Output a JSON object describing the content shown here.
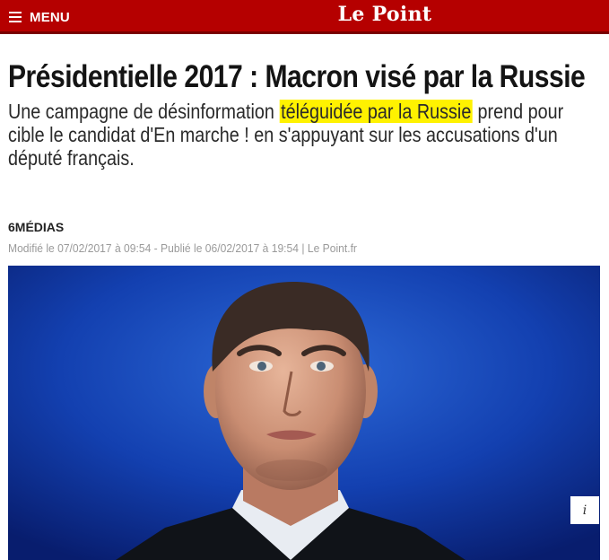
{
  "header": {
    "menu_label": "MENU",
    "brand": "Le Point"
  },
  "article": {
    "title": "Présidentielle 2017 : Macron visé par la Russie",
    "lede_before": "Une campagne de désinformation ",
    "lede_highlight": "téléguidée par la Russie",
    "lede_after": " prend pour cible le candidat d'En marche ! en s'appuyant sur les accusations d'un député français.",
    "author": "6MÉDIAS",
    "dates": "Modifié le 07/02/2017 à 09:54 - Publié le 06/02/2017 à 19:54 | Le Point.fr",
    "info_label": "i"
  },
  "icons": {
    "menu": "hamburger-icon",
    "info": "info-icon"
  },
  "colors": {
    "brand_red": "#b50000",
    "highlight": "#fff200",
    "photo_background": "#0d2a86"
  }
}
